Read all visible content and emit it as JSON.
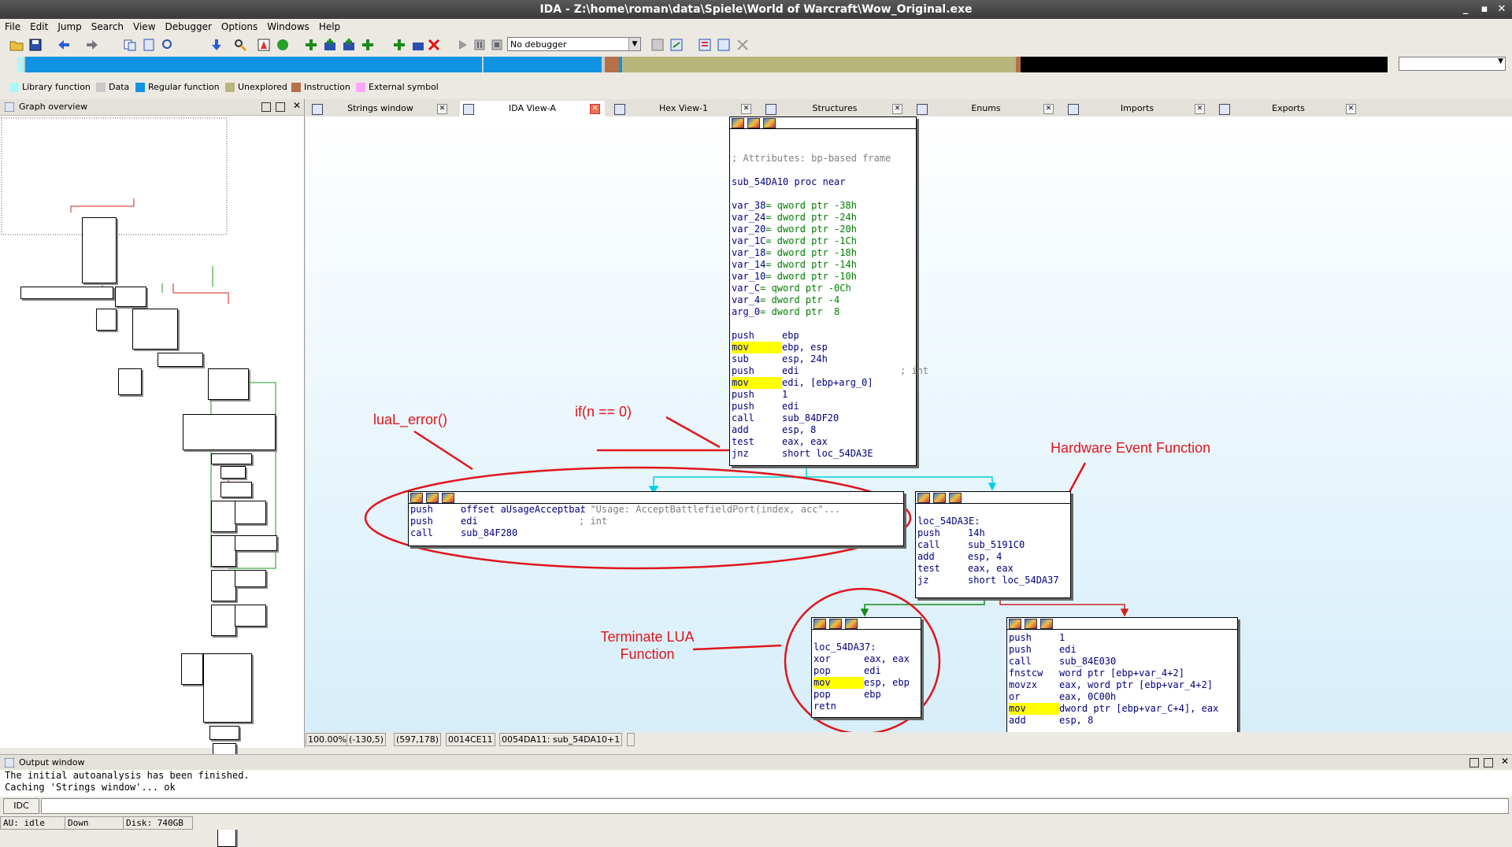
{
  "window": {
    "title": "IDA - Z:\\home\\roman\\data\\Spiele\\World of Warcraft\\Wow_Original.exe",
    "minimize": "_",
    "maximize": "▪",
    "close": "✕"
  },
  "menu": [
    "File",
    "Edit",
    "Jump",
    "Search",
    "View",
    "Debugger",
    "Options",
    "Windows",
    "Help"
  ],
  "toolbar": {
    "debugger_select": "No debugger"
  },
  "nav_colors": {
    "library": "#b0f6f6",
    "data": "#c8c8c8",
    "regular": "#1094e2",
    "unexplored": "#b7b77c",
    "instruction": "#b5714a",
    "external": "#ffa6ff",
    "black": "#000000"
  },
  "legend": [
    {
      "label": "Library function",
      "color": "#b0f6f6"
    },
    {
      "label": "Data",
      "color": "#c8c8c8"
    },
    {
      "label": "Regular function",
      "color": "#1094e2"
    },
    {
      "label": "Unexplored",
      "color": "#b7b77c"
    },
    {
      "label": "Instruction",
      "color": "#b5714a"
    },
    {
      "label": "External symbol",
      "color": "#ffa6ff"
    }
  ],
  "graph_overview": {
    "title": "Graph overview"
  },
  "tabs": [
    {
      "label": "Strings window",
      "icon": "strings-icon"
    },
    {
      "label": "IDA View-A",
      "icon": "graph-view-icon",
      "active": true
    },
    {
      "label": "Hex View-1",
      "icon": "hex-icon"
    },
    {
      "label": "Structures",
      "icon": "structures-icon"
    },
    {
      "label": "Enums",
      "icon": "enums-icon"
    },
    {
      "label": "Imports",
      "icon": "imports-icon"
    },
    {
      "label": "Exports",
      "icon": "exports-icon"
    }
  ],
  "nodes": {
    "main": {
      "attr": "; Attributes: bp-based frame",
      "proc": "sub_54DA10 proc near",
      "vars": [
        [
          "var_38",
          "= qword ptr -38h"
        ],
        [
          "var_24",
          "= dword ptr -24h"
        ],
        [
          "var_20",
          "= dword ptr -20h"
        ],
        [
          "var_1C",
          "= dword ptr -1Ch"
        ],
        [
          "var_18",
          "= dword ptr -18h"
        ],
        [
          "var_14",
          "= dword ptr -14h"
        ],
        [
          "var_10",
          "= dword ptr -10h"
        ],
        [
          "var_C",
          "= qword ptr -0Ch"
        ],
        [
          "var_4",
          "= dword ptr -4"
        ],
        [
          "arg_0",
          "= dword ptr  8"
        ]
      ],
      "code": [
        [
          "push",
          "ebp",
          ""
        ],
        [
          "mov",
          "ebp, esp",
          ""
        ],
        [
          "sub",
          "esp, 24h",
          ""
        ],
        [
          "push",
          "edi",
          "; int"
        ],
        [
          "mov",
          "edi, [ebp+arg_0]",
          ""
        ],
        [
          "push",
          "1",
          ""
        ],
        [
          "push",
          "edi",
          ""
        ],
        [
          "call",
          "sub_84DF20",
          ""
        ],
        [
          "add",
          "esp, 8",
          ""
        ],
        [
          "test",
          "eax, eax",
          ""
        ],
        [
          "jnz",
          "short loc_54DA3E",
          ""
        ]
      ]
    },
    "error": {
      "code": [
        [
          "push",
          "offset aUsageAcceptbat",
          "; \"Usage: AcceptBattlefieldPort(index, acc\"..."
        ],
        [
          "push",
          "edi",
          "; int"
        ],
        [
          "call",
          "sub_84F280",
          ""
        ]
      ]
    },
    "hw": {
      "label": "loc_54DA3E:",
      "code": [
        [
          "push",
          "14h",
          ""
        ],
        [
          "call",
          "sub_5191C0",
          ""
        ],
        [
          "add",
          "esp, 4",
          ""
        ],
        [
          "test",
          "eax, eax",
          ""
        ],
        [
          "jz",
          "short loc_54DA37",
          ""
        ]
      ]
    },
    "term": {
      "label": "loc_54DA37:",
      "code": [
        [
          "xor",
          "eax, eax",
          ""
        ],
        [
          "pop",
          "edi",
          ""
        ],
        [
          "mov",
          "esp, ebp",
          ""
        ],
        [
          "pop",
          "ebp",
          ""
        ],
        [
          "retn",
          "",
          ""
        ]
      ]
    },
    "tail": {
      "code": [
        [
          "push",
          "1",
          ""
        ],
        [
          "push",
          "edi",
          ""
        ],
        [
          "call",
          "sub_84E030",
          ""
        ],
        [
          "fnstcw",
          "word ptr [ebp+var_4+2]",
          ""
        ],
        [
          "movzx",
          "eax, word ptr [ebp+var_4+2]",
          ""
        ],
        [
          "or",
          "eax, 0C00h",
          ""
        ],
        [
          "mov",
          "dword ptr [ebp+var_C+4], eax",
          ""
        ],
        [
          "add",
          "esp, 8",
          ""
        ]
      ]
    }
  },
  "annotations": {
    "lual_error": "luaL_error()",
    "if_n": "if(n == 0)",
    "hardware": "Hardware Event Function",
    "terminate_line1": "Terminate LUA",
    "terminate_line2": "Function"
  },
  "graph_status": [
    "100.00%",
    "(-130,5)",
    "(597,178)",
    "0014CE11",
    "0054DA11: sub_54DA10+1"
  ],
  "output": {
    "title": "Output window",
    "lines": [
      "The initial autoanalysis has been finished.",
      "Caching 'Strings window'... ok"
    ]
  },
  "idc_button": "IDC",
  "status": {
    "au": "AU:  idle",
    "dir": "Down",
    "disk": "Disk: 740GB"
  }
}
